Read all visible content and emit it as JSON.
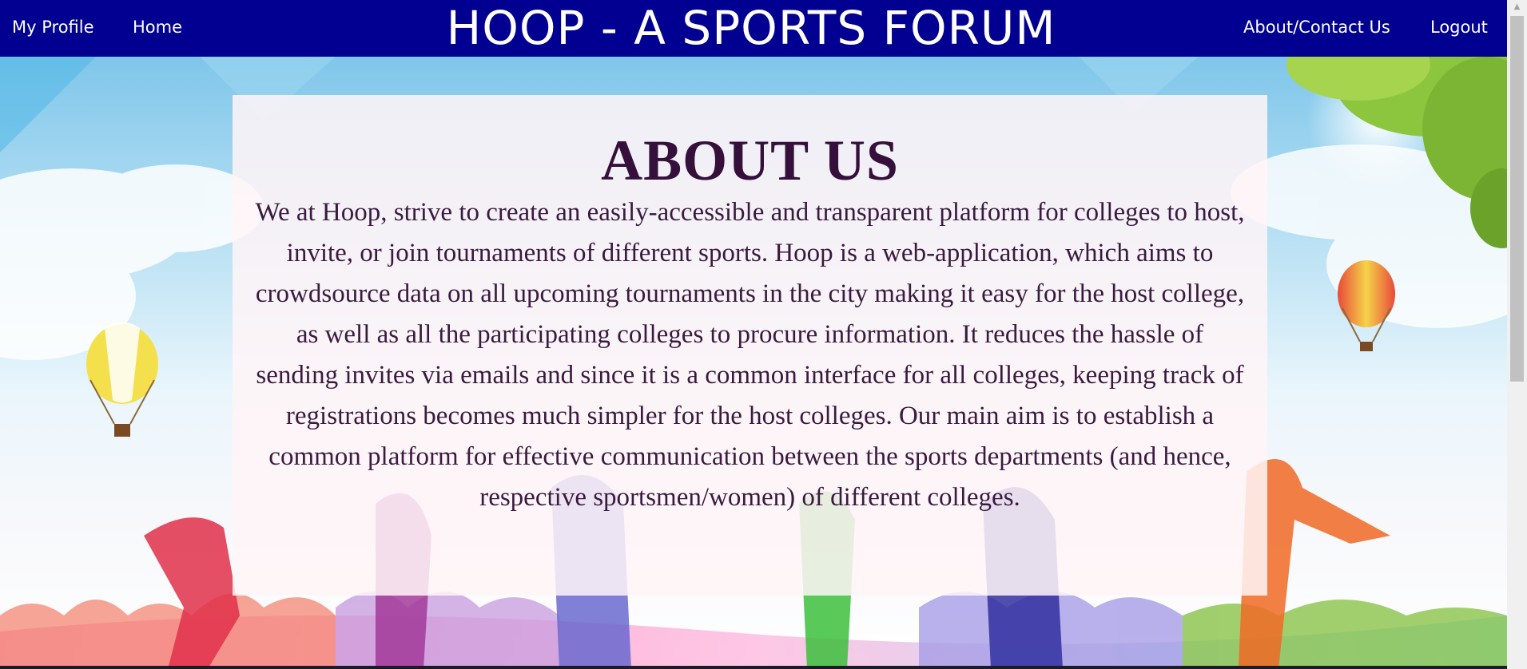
{
  "navbar": {
    "my_profile": "My Profile",
    "home": "Home",
    "brand_title": "HOOP - A SPORTS FORUM",
    "about_contact": "About/Contact Us",
    "logout": "Logout",
    "bg_color": "#010090"
  },
  "about": {
    "heading": "ABOUT US",
    "body": "We at Hoop, strive to create an easily-accessible and transparent platform for colleges to host, invite, or join tournaments of different sports. Hoop is a web-application, which aims to crowdsource data on all upcoming tournaments in the city making it easy for the host college, as well as all the participating colleges to procure information. It reduces the hassle of sending invites via emails and since it is a common interface for all colleges, keeping track of registrations becomes much simpler for the host colleges. Our main aim is to establish a common platform for effective communication between the sports departments (and hence, respective sportsmen/women) of different colleges."
  },
  "background": {
    "description_icons": [
      "hot-air-balloon-icon",
      "tree-icon",
      "sports-silhouettes"
    ],
    "heading_color": "#34103a"
  },
  "scrollbar": {
    "up_arrow": "▲"
  }
}
